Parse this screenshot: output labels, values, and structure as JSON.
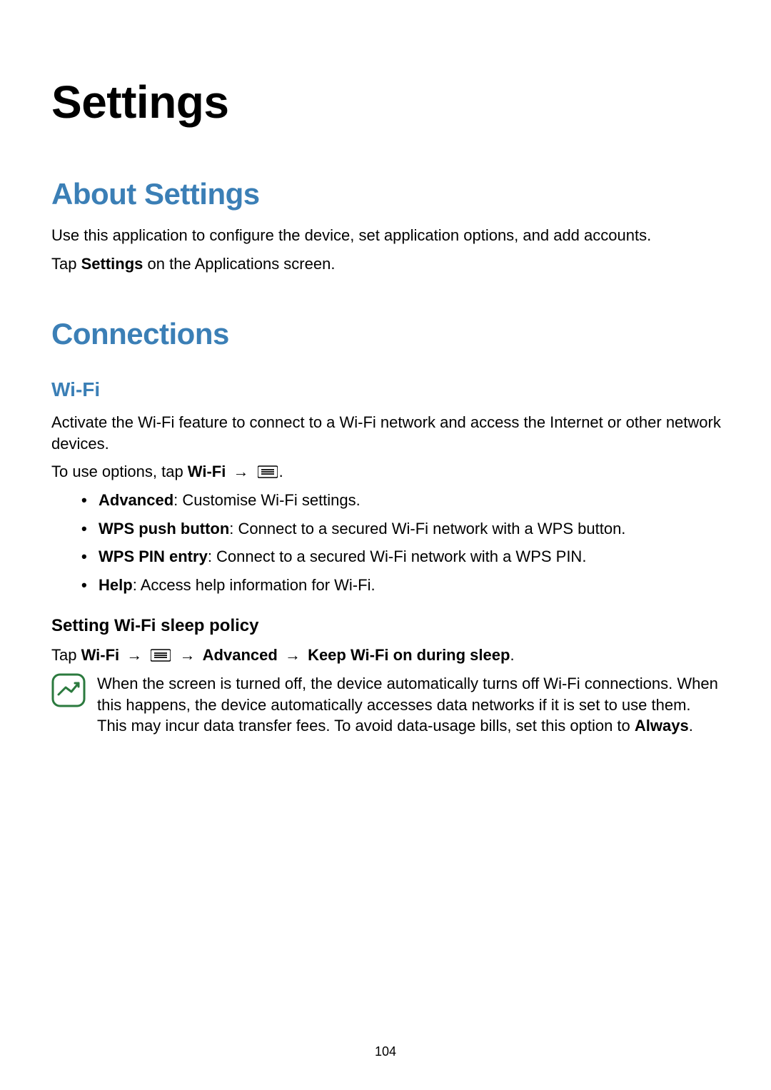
{
  "page_number": "104",
  "title": "Settings",
  "about": {
    "heading": "About Settings",
    "p1": "Use this application to configure the device, set application options, and add accounts.",
    "p2_pre": "Tap ",
    "p2_bold": "Settings",
    "p2_post": " on the Applications screen."
  },
  "connections": {
    "heading": "Connections",
    "wifi": {
      "heading": "Wi-Fi",
      "p1": "Activate the Wi-Fi feature to connect to a Wi-Fi network and access the Internet or other network devices.",
      "options_pre": "To use options, tap ",
      "options_bold": "Wi-Fi",
      "options_arrow": "→",
      "options_post": ".",
      "bullets": [
        {
          "bold": "Advanced",
          "rest": ": Customise Wi-Fi settings."
        },
        {
          "bold": "WPS push button",
          "rest": ": Connect to a secured Wi-Fi network with a WPS button."
        },
        {
          "bold": "WPS PIN entry",
          "rest": ": Connect to a secured Wi-Fi network with a WPS PIN."
        },
        {
          "bold": "Help",
          "rest": ": Access help information for Wi-Fi."
        }
      ],
      "sleep": {
        "heading": "Setting Wi-Fi sleep policy",
        "path_pre": "Tap ",
        "path_b1": "Wi-Fi",
        "arrow": "→",
        "path_b2": "Advanced",
        "path_b3": "Keep Wi-Fi on during sleep",
        "path_post": ".",
        "note_text": "When the screen is turned off, the device automatically turns off Wi-Fi connections. When this happens, the device automatically accesses data networks if it is set to use them. This may incur data transfer fees. To avoid data-usage bills, set this option to ",
        "note_bold": "Always",
        "note_post": "."
      }
    }
  }
}
